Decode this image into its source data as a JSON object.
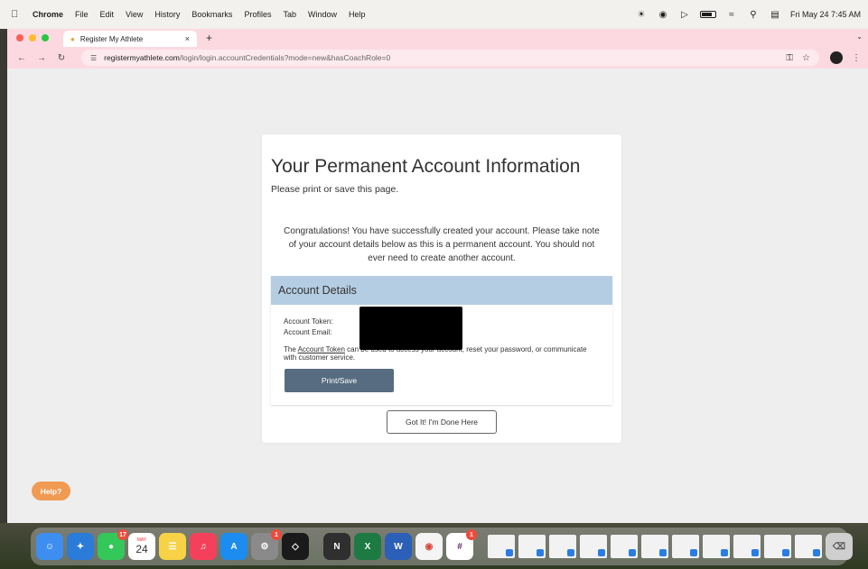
{
  "menubar": {
    "app": "Chrome",
    "items": [
      "File",
      "Edit",
      "View",
      "History",
      "Bookmarks",
      "Profiles",
      "Tab",
      "Window",
      "Help"
    ],
    "datetime": "Fri May 24  7:45 AM"
  },
  "browser": {
    "tab_title": "Register My Athlete",
    "url_domain": "registermyathlete.com",
    "url_path": "/login/login.accountCredentials?mode=new&hasCoachRole=0"
  },
  "page": {
    "title": "Your Permanent Account Information",
    "subtitle": "Please print or save this page.",
    "congrats": "Congratulations! You have successfully created your account. Please take note of your account details below as this is a permanent account. You should not ever need to create another account.",
    "details": {
      "heading": "Account Details",
      "token_label": "Account Token:",
      "email_label": "Account Email:",
      "note_prefix": "The ",
      "note_link": "Account Token",
      "note_suffix": " can be used to access your account, reset your password, or communicate with customer service.",
      "print_label": "Print/Save"
    },
    "done_label": "Got It! I'm Done Here",
    "help_label": "Help?"
  },
  "dock": {
    "messages_badge": "17",
    "calendar_month": "MAY",
    "calendar_day": "24",
    "settings_badge": "1",
    "slack_badge": "1"
  },
  "colors": {
    "tab_strip": "#fcd9e1",
    "details_header": "#b5cde3",
    "print_button": "#576c80",
    "help_button": "#f09a52"
  }
}
